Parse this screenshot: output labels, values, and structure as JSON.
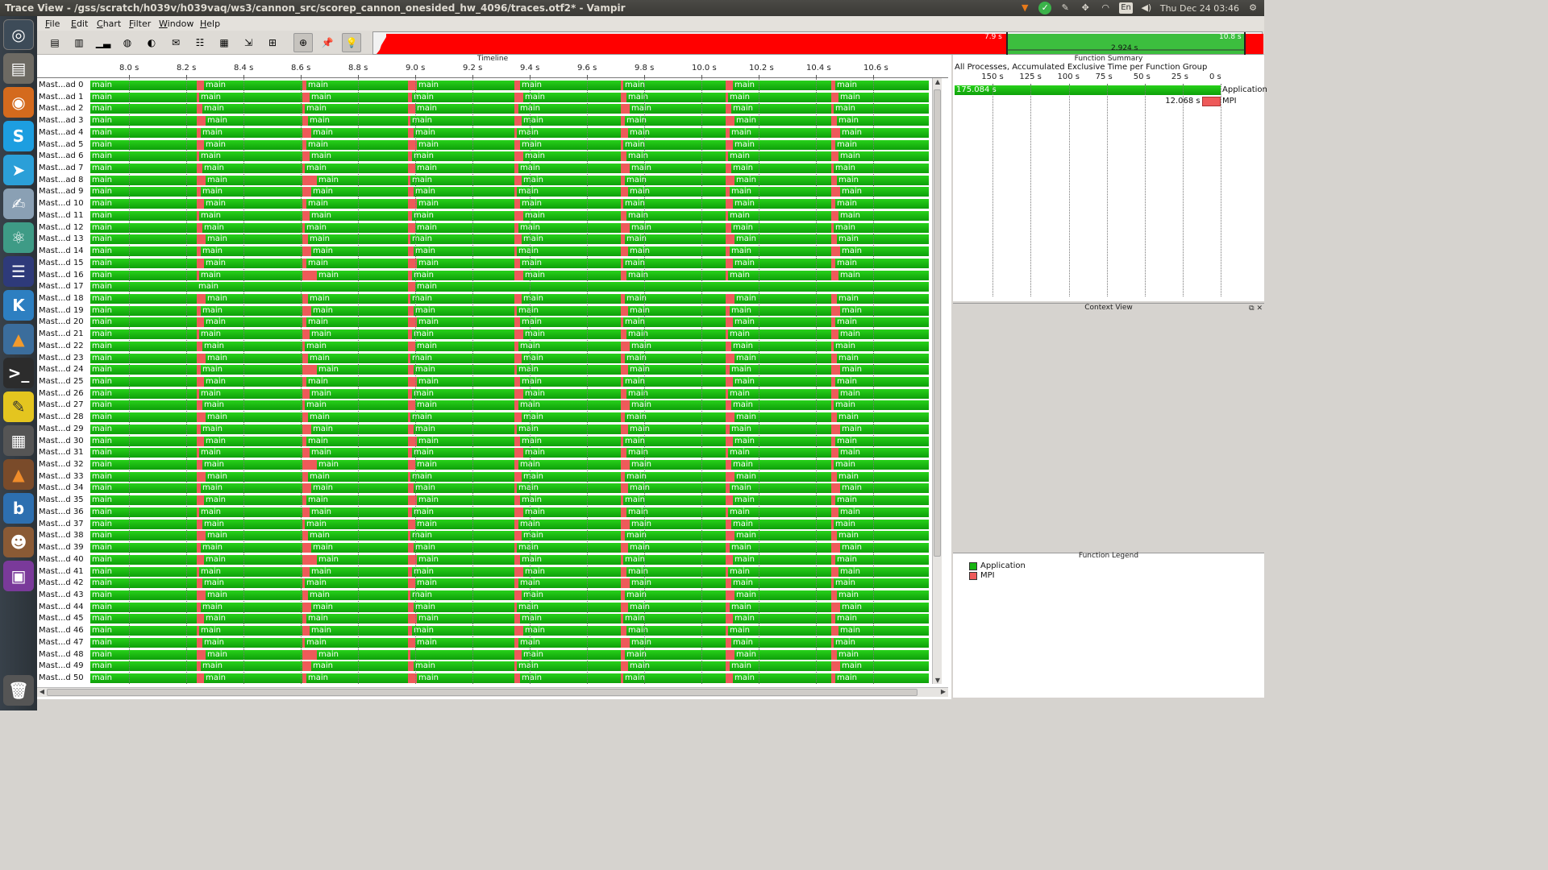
{
  "window": {
    "title": "Trace View - /gss/scratch/h039v/h039vaq/ws3/cannon_src/scorep_cannon_onesided_hw_4096/traces.otf2* - Vampir"
  },
  "tray": {
    "lang": "En",
    "clock": "Thu Dec 24 03:46"
  },
  "menu": [
    {
      "label": "File"
    },
    {
      "label": "Edit"
    },
    {
      "label": "Chart"
    },
    {
      "label": "Filter"
    },
    {
      "label": "Window"
    },
    {
      "label": "Help"
    }
  ],
  "overview": {
    "start_label": "7.9 s",
    "end_label": "10.8 s",
    "duration_label": "2.924 s"
  },
  "timeline": {
    "title": "Timeline",
    "function_name": "main",
    "ticks": [
      "8.0 s",
      "8.2 s",
      "8.4 s",
      "8.6 s",
      "8.8 s",
      "9.0 s",
      "9.2 s",
      "9.4 s",
      "9.6 s",
      "9.8 s",
      "10.0 s",
      "10.2 s",
      "10.4 s",
      "10.6 s"
    ],
    "processes": [
      "Mast...ad 0",
      "Mast...ad 1",
      "Mast...ad 2",
      "Mast...ad 3",
      "Mast...ad 4",
      "Mast...ad 5",
      "Mast...ad 6",
      "Mast...ad 7",
      "Mast...ad 8",
      "Mast...ad 9",
      "Mast...d 10",
      "Mast...d 11",
      "Mast...d 12",
      "Mast...d 13",
      "Mast...d 14",
      "Mast...d 15",
      "Mast...d 16",
      "Mast...d 17",
      "Mast...d 18",
      "Mast...d 19",
      "Mast...d 20",
      "Mast...d 21",
      "Mast...d 22",
      "Mast...d 23",
      "Mast...d 24",
      "Mast...d 25",
      "Mast...d 26",
      "Mast...d 27",
      "Mast...d 28",
      "Mast...d 29",
      "Mast...d 30",
      "Mast...d 31",
      "Mast...d 32",
      "Mast...d 33",
      "Mast...d 34",
      "Mast...d 35",
      "Mast...d 36",
      "Mast...d 37",
      "Mast...d 38",
      "Mast...d 39",
      "Mast...d 40",
      "Mast...d 41",
      "Mast...d 42",
      "Mast...d 43",
      "Mast...d 44",
      "Mast...d 45",
      "Mast...d 46",
      "Mast...d 47",
      "Mast...d 48",
      "Mast...d 49",
      "Mast...d 50"
    ]
  },
  "function_summary": {
    "title": "Function Summary",
    "subtitle": "All Processes, Accumulated Exclusive Time per Function Group",
    "axis_ticks": [
      "150 s",
      "125 s",
      "100 s",
      "75 s",
      "50 s",
      "25 s",
      "0 s"
    ],
    "groups": [
      {
        "name": "Application",
        "value_label": "175.084 s",
        "value": 175.084,
        "color": "#18b512"
      },
      {
        "name": "MPI",
        "value_label": "12.068 s",
        "value": 12.068,
        "color": "#ee5a5a"
      }
    ]
  },
  "context_view": {
    "title": "Context View"
  },
  "function_legend": {
    "title": "Function Legend",
    "items": [
      {
        "label": "Application",
        "color": "#18b512"
      },
      {
        "label": "MPI",
        "color": "#ee5a5a"
      }
    ]
  }
}
